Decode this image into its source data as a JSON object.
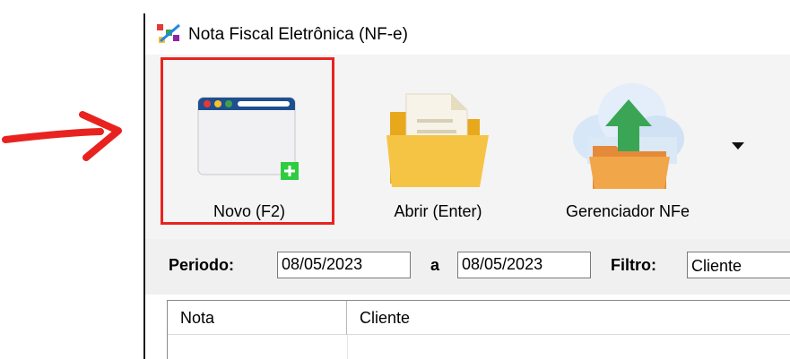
{
  "window": {
    "title": "Nota Fiscal Eletrônica (NF-e)"
  },
  "toolbar": {
    "buttons": [
      {
        "id": "novo",
        "label": "Novo (F2)",
        "icon": "new-document-icon",
        "highlighted": true
      },
      {
        "id": "abrir",
        "label": "Abrir (Enter)",
        "icon": "folder-open-icon"
      },
      {
        "id": "gerenciador",
        "label": "Gerenciador NFe",
        "icon": "cloud-upload-icon"
      }
    ]
  },
  "filters": {
    "periodo_label": "Periodo:",
    "date_from": "08/05/2023",
    "range_sep": "a",
    "date_to": "08/05/2023",
    "filtro_label": "Filtro:",
    "filtro_value": "Cliente"
  },
  "grid": {
    "columns": [
      "Nota",
      "Cliente"
    ]
  },
  "colors": {
    "highlight": "#e8231f",
    "arrow": "#e8231f",
    "toolbar_bg": "#f4f4f4"
  }
}
